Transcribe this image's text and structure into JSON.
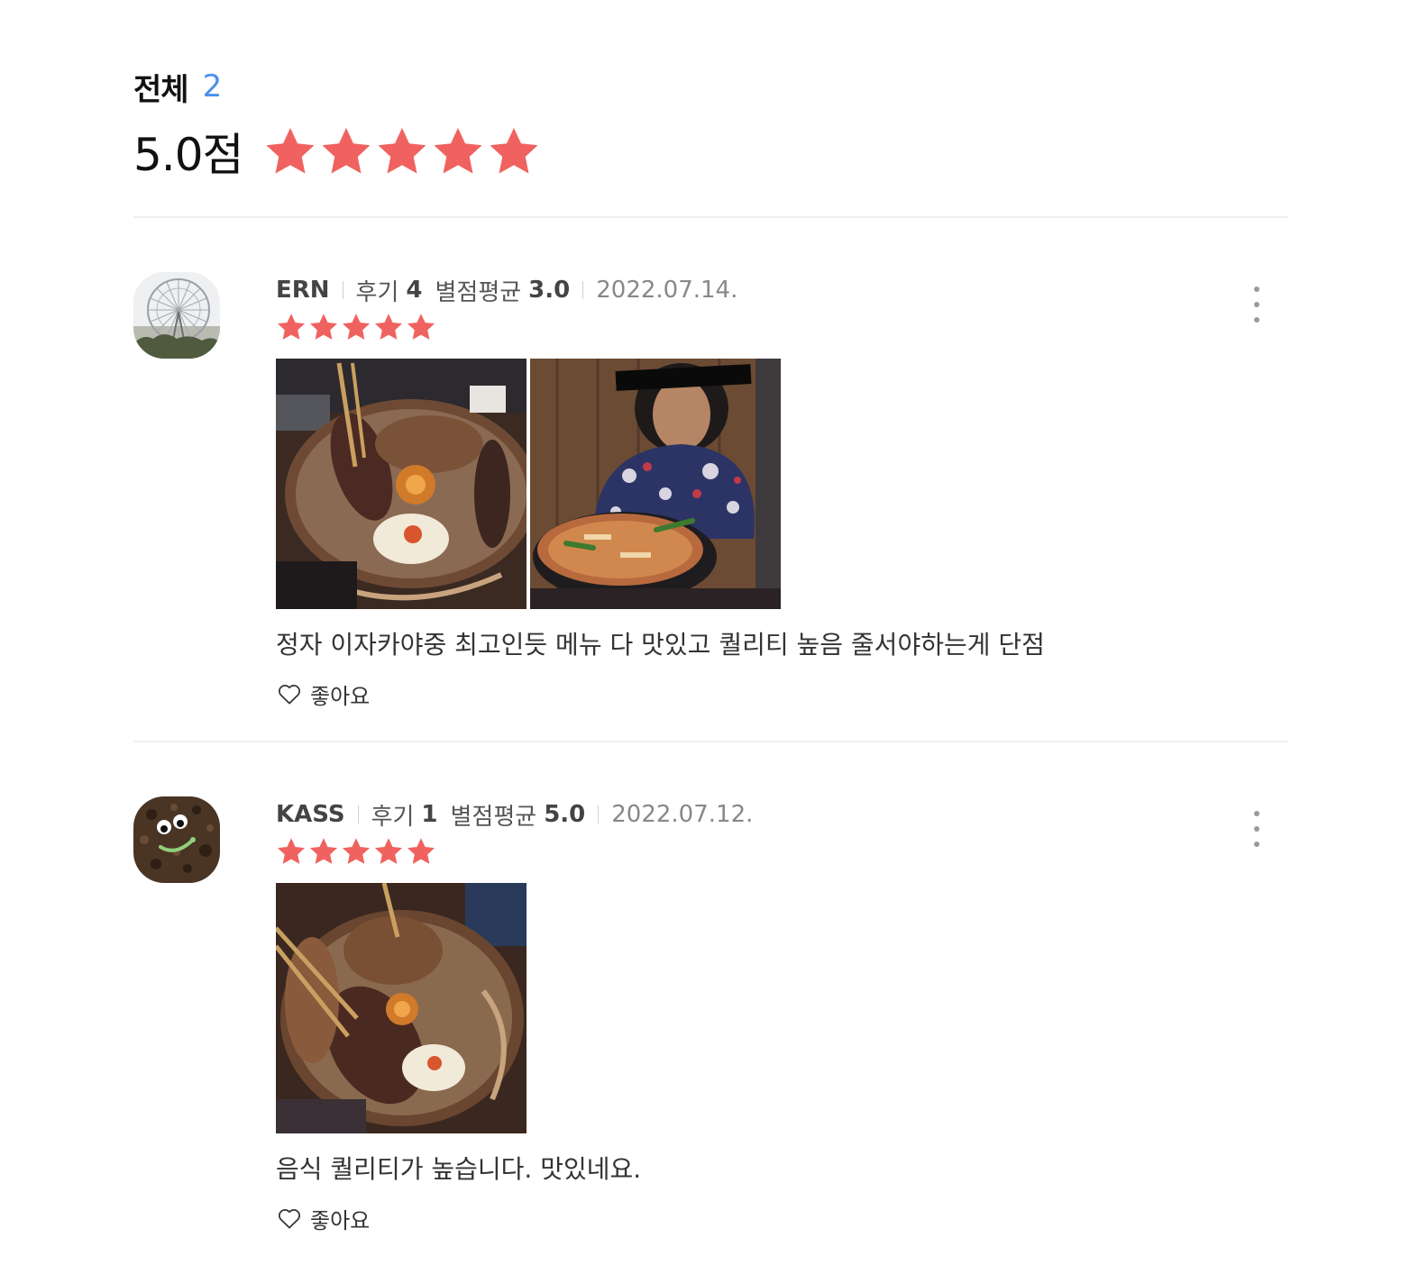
{
  "summary": {
    "label": "전체",
    "count": "2",
    "score_text": "5.0점",
    "rating": 5,
    "max_rating": 5,
    "star_color": "#f0625f"
  },
  "reviews": [
    {
      "author": "ERN",
      "review_count_label": "후기",
      "review_count": "4",
      "avg_label": "별점평균",
      "avg": "3.0",
      "date": "2022.07.14.",
      "rating": 5,
      "avatar_icon": "ferris-wheel-photo",
      "photos": [
        "grilled-skewers-platter-photo",
        "person-with-hotpot-photo"
      ],
      "text": "정자 이자카야중 최고인듯 메뉴 다 맛있고 퀄리티 높음 줄서야하는게 단점",
      "like_label": "좋아요"
    },
    {
      "author": "KASS",
      "review_count_label": "후기",
      "review_count": "1",
      "avg_label": "별점평균",
      "avg": "5.0",
      "date": "2022.07.12.",
      "rating": 5,
      "avatar_icon": "cookie-face-photo",
      "photos": [
        "grilled-skewers-platter-photo"
      ],
      "text": "음식 퀄리티가 높습니다. 맛있네요.",
      "like_label": "좋아요"
    }
  ]
}
